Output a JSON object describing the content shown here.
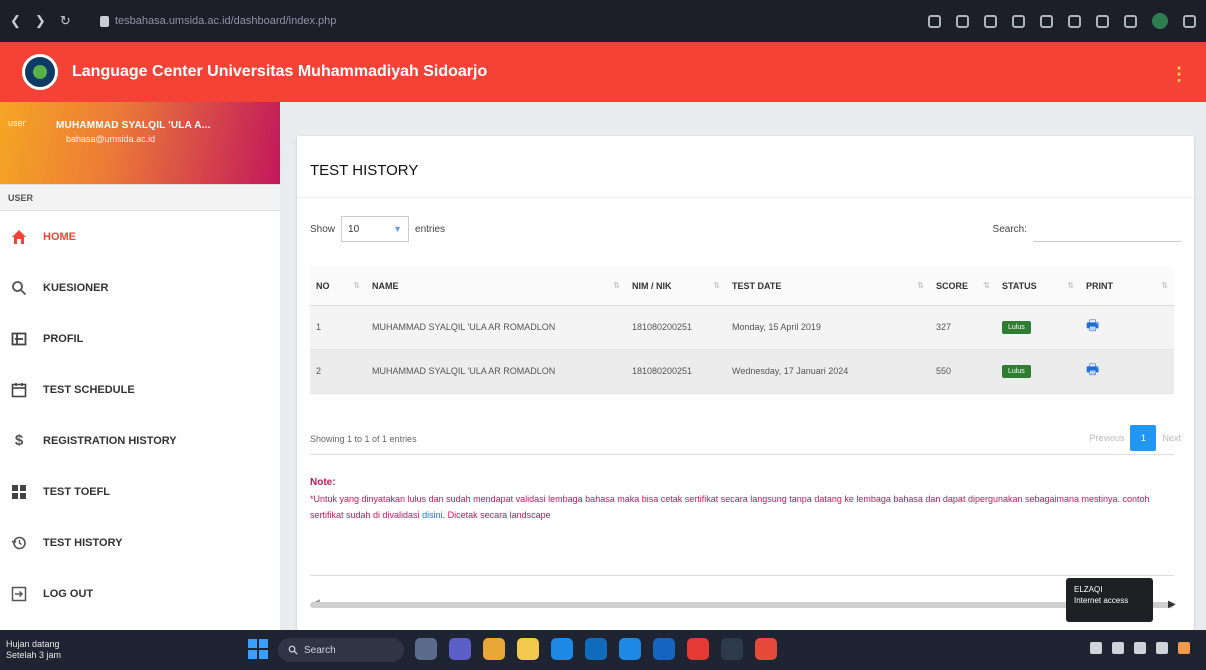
{
  "browser": {
    "url": "tesbahasa.umsida.ac.id/dashboard/index.php"
  },
  "header": {
    "title": "Language Center Universitas Muhammadiyah Sidoarjo"
  },
  "user": {
    "avatar_alt": "user",
    "name": "MUHAMMAD SYALQIL 'ULA A...",
    "email": "bahasa@umsida.ac.id"
  },
  "sidebar": {
    "section": "USER",
    "items": [
      {
        "label": "HOME",
        "icon": "home-icon"
      },
      {
        "label": "KUESIONER",
        "icon": "search-icon"
      },
      {
        "label": "PROFIL",
        "icon": "profile-card-icon"
      },
      {
        "label": "TEST SCHEDULE",
        "icon": "calendar-icon"
      },
      {
        "label": "REGISTRATION HISTORY",
        "icon": "dollar-icon"
      },
      {
        "label": "TEST TOEFL",
        "icon": "grid-icon"
      },
      {
        "label": "TEST HISTORY",
        "icon": "history-icon"
      },
      {
        "label": "LOG OUT",
        "icon": "logout-icon"
      }
    ]
  },
  "card": {
    "title": "TEST HISTORY",
    "show_label": "Show",
    "entries_value": "10",
    "entries_label": "entries",
    "search_label": "Search:",
    "columns": [
      "NO",
      "NAME",
      "NIM / NIK",
      "TEST DATE",
      "SCORE",
      "STATUS",
      "PRINT"
    ],
    "rows": [
      {
        "no": "1",
        "name": "MUHAMMAD SYALQIL 'ULA AR ROMADLON",
        "nim": "181080200251",
        "date": "Monday, 15 April 2019",
        "score": "327",
        "status": "Lulus"
      },
      {
        "no": "2",
        "name": "MUHAMMAD SYALQIL 'ULA AR ROMADLON",
        "nim": "181080200251",
        "date": "Wednesday, 17 Januari 2024",
        "score": "550",
        "status": "Lulus"
      }
    ],
    "info": "Showing 1 to 1 of 1 entries",
    "pager": {
      "previous": "Previous",
      "page": "1",
      "next": "Next"
    },
    "note_label": "Note:",
    "note_text": "*Untuk yang dinyatakan lulus dan sudah mendapat validasi lembaga bahasa maka bisa cetak sertifikat secara langsung tanpa datang ke lembaga bahasa dan dapat dipergunakan sebagaimana mestinya. contoh sertifikat sudah di divalidasi ",
    "note_link": "disini",
    "note_tail": ". Dicetak secara landscape"
  },
  "tooltip": {
    "title": "ELZAQI",
    "subtitle": "Internet access"
  },
  "taskbar": {
    "weather_line1": "Hujan datang",
    "weather_line2": "Setelah 3 jam",
    "search": "Search"
  },
  "colors": {
    "header": "#f44336",
    "accent_blue": "#2196f3",
    "status_green": "#2e7d32",
    "note": "#c2185b"
  }
}
